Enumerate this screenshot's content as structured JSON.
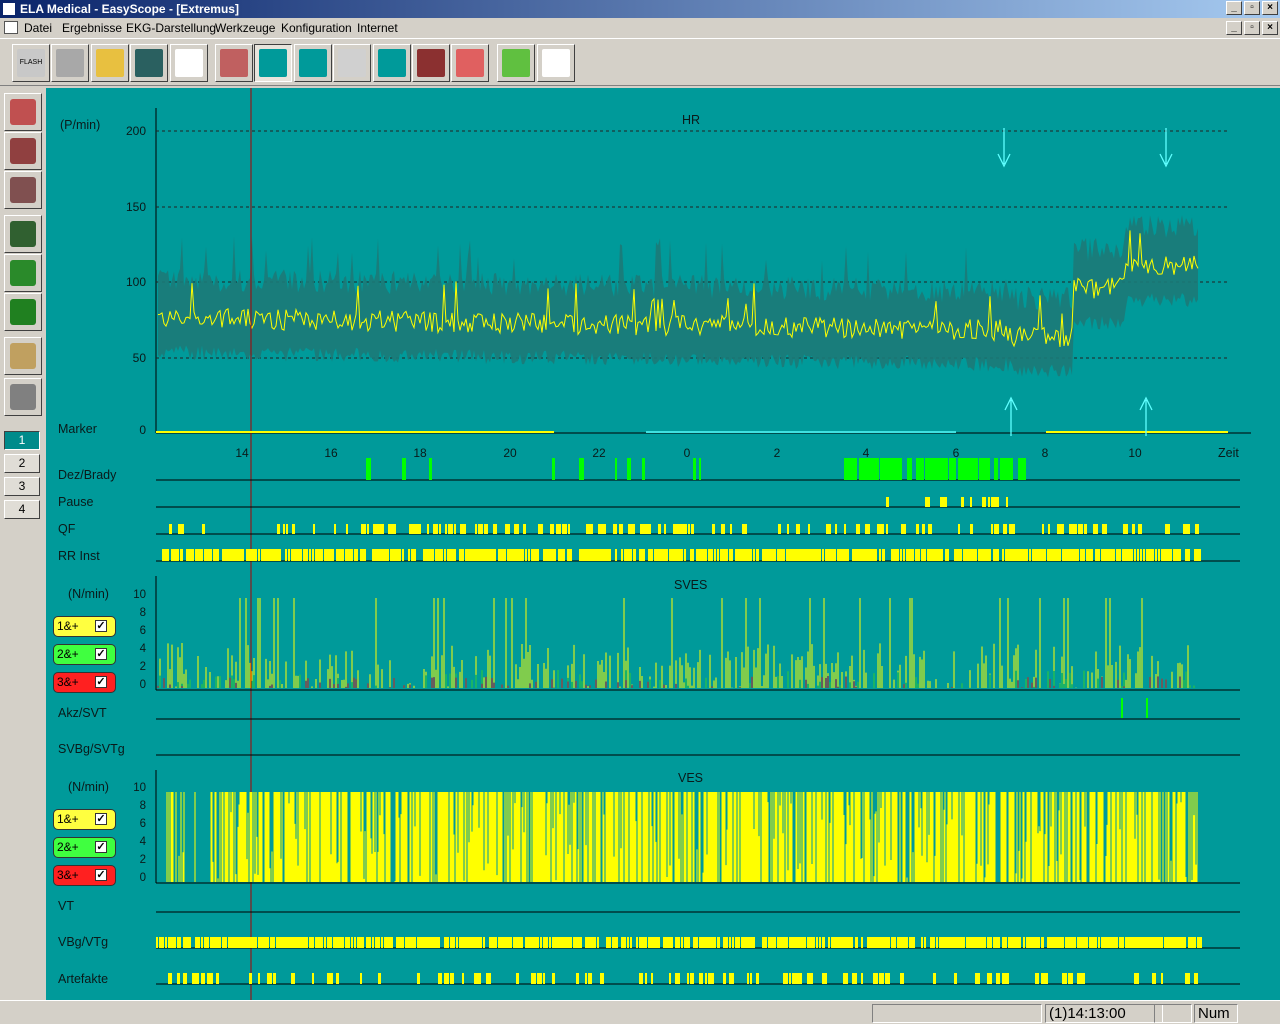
{
  "window": {
    "title": "ELA Medical - EasyScope - [Extremus]"
  },
  "menu": [
    "Datei",
    "Ergebnisse",
    "EKG-Darstellung",
    "Werkzeuge",
    "Konfiguration",
    "Internet"
  ],
  "toolbar": [
    {
      "name": "flash-button",
      "icon": "flash-card-icon",
      "label": "FLASH"
    },
    {
      "name": "camera-device-button",
      "icon": "recorder-icon"
    },
    {
      "name": "open-button",
      "icon": "folder-open-icon"
    },
    {
      "name": "save-button",
      "icon": "floppy-icon"
    },
    {
      "name": "patient-button",
      "icon": "person-icon"
    },
    {
      "name": "trend-nva-button",
      "icon": "trend-grid-icon"
    },
    {
      "name": "hr-trend-button",
      "icon": "ecg-wave-icon"
    },
    {
      "name": "ecg-marker-button",
      "icon": "ecg-marker-icon"
    },
    {
      "name": "blank-button",
      "icon": "blank-sheet-icon"
    },
    {
      "name": "histogram-button",
      "icon": "histogram-icon"
    },
    {
      "name": "fullscreen-ecg-button",
      "icon": "ecg-strip-icon"
    },
    {
      "name": "report-button",
      "icon": "report-icon"
    },
    {
      "name": "timer-button",
      "icon": "stopwatch-icon"
    },
    {
      "name": "help-button",
      "icon": "help-logo-icon"
    }
  ],
  "sidebar": {
    "tools": [
      "ecg-view-icon",
      "full-disclosure-icon",
      "superimpose-icon",
      "snapshot-icon",
      "magnifier-icon",
      "trash-icon",
      "notepad-icon",
      "printer-icon"
    ],
    "pages": [
      "1",
      "2",
      "3",
      "4"
    ],
    "active_page": "1"
  },
  "hr_panel": {
    "title": "HR",
    "unit": "(P/min)",
    "y_ticks": [
      "200",
      "150",
      "100",
      "50",
      "0"
    ],
    "x_ticks": [
      "14",
      "16",
      "18",
      "20",
      "22",
      "0",
      "2",
      "4",
      "6",
      "8",
      "10"
    ],
    "x_label": "Zeit",
    "marker_label": "Marker"
  },
  "event_rows": [
    "Dez/Brady",
    "Pause",
    "QF",
    "RR Inst"
  ],
  "sves_panel": {
    "title": "SVES",
    "unit": "(N/min)",
    "y_ticks": [
      "10",
      "8",
      "6",
      "4",
      "2",
      "0"
    ],
    "checks": [
      {
        "label": "1&+",
        "color": "#ffff40"
      },
      {
        "label": "2&+",
        "color": "#40ff40"
      },
      {
        "label": "3&+",
        "color": "#ff2020"
      }
    ]
  },
  "sves_rows": [
    "Akz/SVT",
    "SVBg/SVTg"
  ],
  "ves_panel": {
    "title": "VES",
    "unit": "(N/min)",
    "y_ticks": [
      "10",
      "8",
      "6",
      "4",
      "2",
      "0"
    ],
    "checks": [
      {
        "label": "1&+",
        "color": "#ffff40"
      },
      {
        "label": "2&+",
        "color": "#40ff40"
      },
      {
        "label": "3&+",
        "color": "#ff2020"
      }
    ]
  },
  "ves_rows": [
    "VT",
    "VBg/VTg",
    "Artefakte"
  ],
  "colors": {
    "background": "#009a9a",
    "trace": "#ffff00",
    "band": "#1c7a78",
    "event": "#ffff00",
    "brady": "#00ff00"
  },
  "statusbar": {
    "time": "(1)14:13:00",
    "num": "Num"
  }
}
